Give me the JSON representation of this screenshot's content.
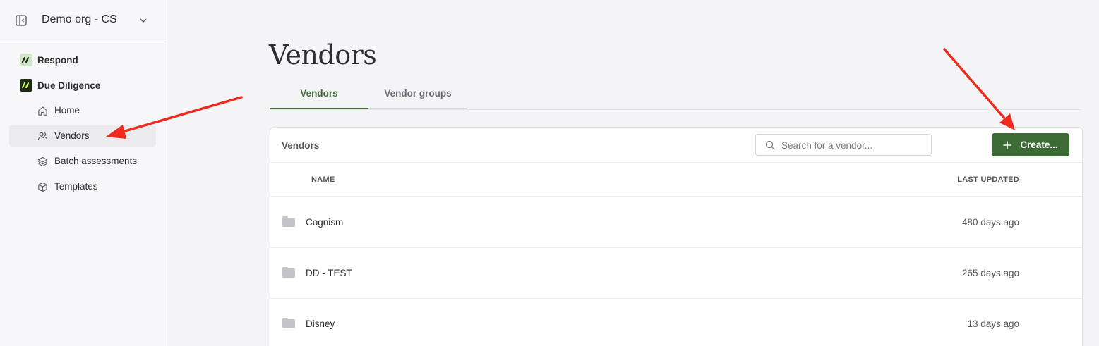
{
  "org": {
    "name": "Demo org - CS"
  },
  "sidebar": {
    "products": [
      {
        "label": "Respond"
      },
      {
        "label": "Due Diligence"
      }
    ],
    "items": [
      {
        "label": "Home",
        "icon": "home-icon"
      },
      {
        "label": "Vendors",
        "icon": "users-icon",
        "active": true
      },
      {
        "label": "Batch assessments",
        "icon": "layers-icon"
      },
      {
        "label": "Templates",
        "icon": "cube-icon"
      }
    ]
  },
  "page": {
    "title": "Vendors",
    "tabs": [
      {
        "label": "Vendors",
        "active": true
      },
      {
        "label": "Vendor groups"
      }
    ]
  },
  "vendors_card": {
    "title": "Vendors",
    "search": {
      "placeholder": "Search for a vendor...",
      "value": ""
    },
    "create_label": "Create...",
    "columns": {
      "name": "NAME",
      "last_updated": "LAST UPDATED"
    },
    "rows": [
      {
        "name": "Cognism",
        "updated": "480 days ago"
      },
      {
        "name": "DD - TEST",
        "updated": "265 days ago"
      },
      {
        "name": "Disney",
        "updated": "13 days ago"
      }
    ]
  },
  "colors": {
    "accent": "#3d6b35",
    "annotation": "#f02a1d"
  }
}
